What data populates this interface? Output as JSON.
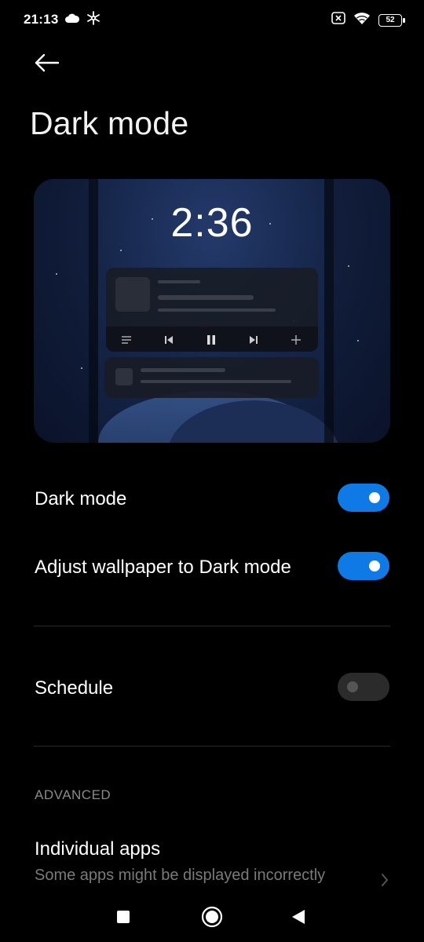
{
  "status_bar": {
    "time": "21:13",
    "battery": "52",
    "icons": [
      "cloud-icon",
      "snowflake-icon",
      "no-sim-icon",
      "wifi-icon",
      "battery-icon"
    ]
  },
  "header": {
    "back_icon": "arrow-left-icon",
    "title": "Dark mode"
  },
  "preview": {
    "clock": "2:36",
    "media_icons": [
      "playlist-icon",
      "skip-previous-icon",
      "pause-icon",
      "skip-next-icon",
      "plus-icon"
    ]
  },
  "settings": {
    "dark_mode": {
      "label": "Dark mode",
      "enabled": true
    },
    "adjust_wallpaper": {
      "label": "Adjust wallpaper to Dark mode",
      "enabled": true
    },
    "schedule": {
      "label": "Schedule",
      "enabled": false
    }
  },
  "advanced": {
    "header": "ADVANCED",
    "individual_apps": {
      "label": "Individual apps",
      "subtitle": "Some apps might be displayed incorrectly"
    }
  },
  "nav_bar": {
    "icons": [
      "recents-square-icon",
      "home-circle-icon",
      "back-triangle-icon"
    ]
  },
  "colors": {
    "accent": "#0f7ae5",
    "background": "#000000",
    "toggle_off": "#2b2b2b",
    "secondary_text": "#7a7a7a"
  }
}
